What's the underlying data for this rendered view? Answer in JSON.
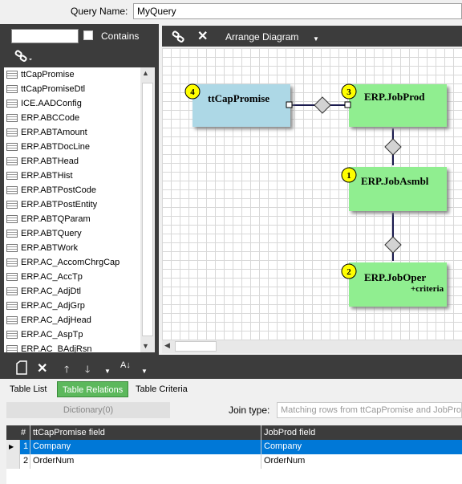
{
  "query": {
    "label": "Query Name:",
    "value": "MyQuery"
  },
  "left": {
    "contains_label": "Contains",
    "tables": [
      "ttCapPromise",
      "ttCapPromiseDtl",
      "ICE.AADConfig",
      "ERP.ABCCode",
      "ERP.ABTAmount",
      "ERP.ABTDocLine",
      "ERP.ABTHead",
      "ERP.ABTHist",
      "ERP.ABTPostCode",
      "ERP.ABTPostEntity",
      "ERP.ABTQParam",
      "ERP.ABTQuery",
      "ERP.ABTWork",
      "ERP.AC_AccomChrgCap",
      "ERP.AC_AccTp",
      "ERP.AC_AdjDtl",
      "ERP.AC_AdjGrp",
      "ERP.AC_AdjHead",
      "ERP.AC_AspTp",
      "ERP.AC_BAdjRsn"
    ]
  },
  "diagram": {
    "arrange_label": "Arrange Diagram",
    "nodes": [
      {
        "num": "4",
        "name": "ttCapPromise",
        "criteria": ""
      },
      {
        "num": "3",
        "name": "ERP.JobProd",
        "criteria": ""
      },
      {
        "num": "1",
        "name": "ERP.JobAsmbl",
        "criteria": ""
      },
      {
        "num": "2",
        "name": "ERP.JobOper",
        "criteria": "+criteria"
      }
    ]
  },
  "tabs": [
    "Table List",
    "Table Relations",
    "Table Criteria"
  ],
  "relations": {
    "dictionary_label": "Dictionary(0)",
    "join_label": "Join type:",
    "join_value": "Matching rows from ttCapPromise and JobProd",
    "columns": [
      "#",
      "ttCapPromise field",
      "JobProd field"
    ],
    "rows": [
      {
        "n": "1",
        "left": "Company",
        "right": "Company"
      },
      {
        "n": "2",
        "left": "OrderNum",
        "right": "OrderNum"
      }
    ]
  },
  "colors": {
    "blue_node": "#add8e6",
    "green_node": "#90ee90",
    "badge": "#ffff00",
    "selected_row": "#0078d7",
    "active_tab": "#5cb85c",
    "dark_panel": "#3c3c3c"
  }
}
